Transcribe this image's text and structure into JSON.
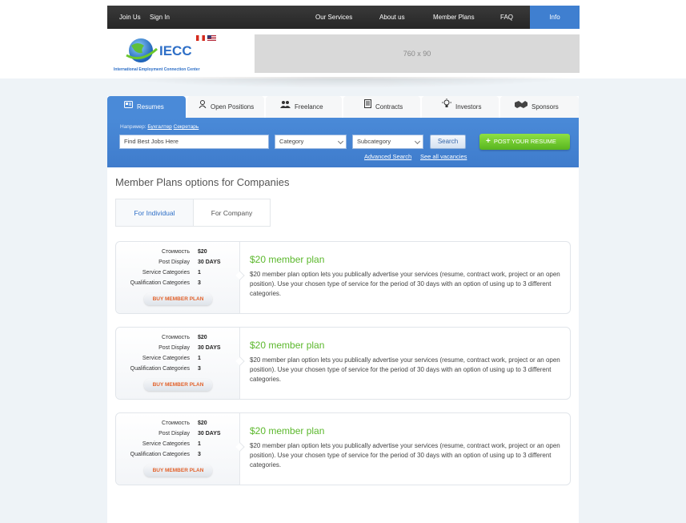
{
  "topnav": {
    "left": [
      "Join Us",
      "Sign In"
    ],
    "right": [
      "Our Services",
      "About us",
      "Member Plans",
      "FAQ",
      "Info"
    ],
    "active": "Info"
  },
  "header": {
    "logo_text": "IECC",
    "logo_subtitle": "International Employment Connection Center",
    "ad_placeholder": "760 x 90"
  },
  "tabs": [
    "Resumes",
    "Open Positions",
    "Freelance",
    "Contracts",
    "Investors",
    "Sponsors"
  ],
  "search": {
    "example_label": "Например:",
    "example_links": [
      "Бухгалтер",
      "Секретарь"
    ],
    "query_placeholder": "Find Best Jobs Here",
    "category": "Category",
    "subcategory": "Subcategory",
    "search_button": "Search",
    "post_button": "POST YOUR RESUME",
    "advanced_search": "Advanced Search",
    "see_all": "See all vacancies"
  },
  "page": {
    "title": "Member Plans options for Companies",
    "segments": [
      "For Individual",
      "For Company"
    ]
  },
  "plans": [
    {
      "rows": [
        {
          "label": "Стоимость",
          "value": "$20"
        },
        {
          "label": "Post Display",
          "value": "30 DAYS"
        },
        {
          "label": "Service Categories",
          "value": "1"
        },
        {
          "label": "Qualification Categories",
          "value": "3"
        }
      ],
      "buy": "BUY MEMBER PLAN",
      "title": "$20 member plan",
      "description": "$20 member plan option lets you publically advertise your services (resume, contract work, project or an open position). Use your chosen type of service for the period of 30 days with an option of using up to 3 different categories."
    },
    {
      "rows": [
        {
          "label": "Стоимость",
          "value": "$20"
        },
        {
          "label": "Post Display",
          "value": "30 DAYS"
        },
        {
          "label": "Service Categories",
          "value": "1"
        },
        {
          "label": "Qualification Categories",
          "value": "3"
        }
      ],
      "buy": "BUY MEMBER PLAN",
      "title": "$20 member plan",
      "description": "$20 member plan option lets you publically advertise your services (resume, contract work, project or an open position). Use your chosen type of service for the period of 30 days with an option of using up to 3 different categories."
    },
    {
      "rows": [
        {
          "label": "Стоимость",
          "value": "$20"
        },
        {
          "label": "Post Display",
          "value": "30 DAYS"
        },
        {
          "label": "Service Categories",
          "value": "1"
        },
        {
          "label": "Qualification Categories",
          "value": "3"
        }
      ],
      "buy": "BUY MEMBER PLAN",
      "title": "$20 member plan",
      "description": "$20 member plan option lets you publically advertise your services (resume, contract work, project or an open position). Use your chosen type of service for the period of 30 days with an option of using up to 3 different categories."
    }
  ],
  "colors": {
    "accent_blue": "#4a8ad8",
    "plan_green": "#5cb82d",
    "buy_orange": "#e2622b",
    "post_green": "#6cc72c"
  }
}
